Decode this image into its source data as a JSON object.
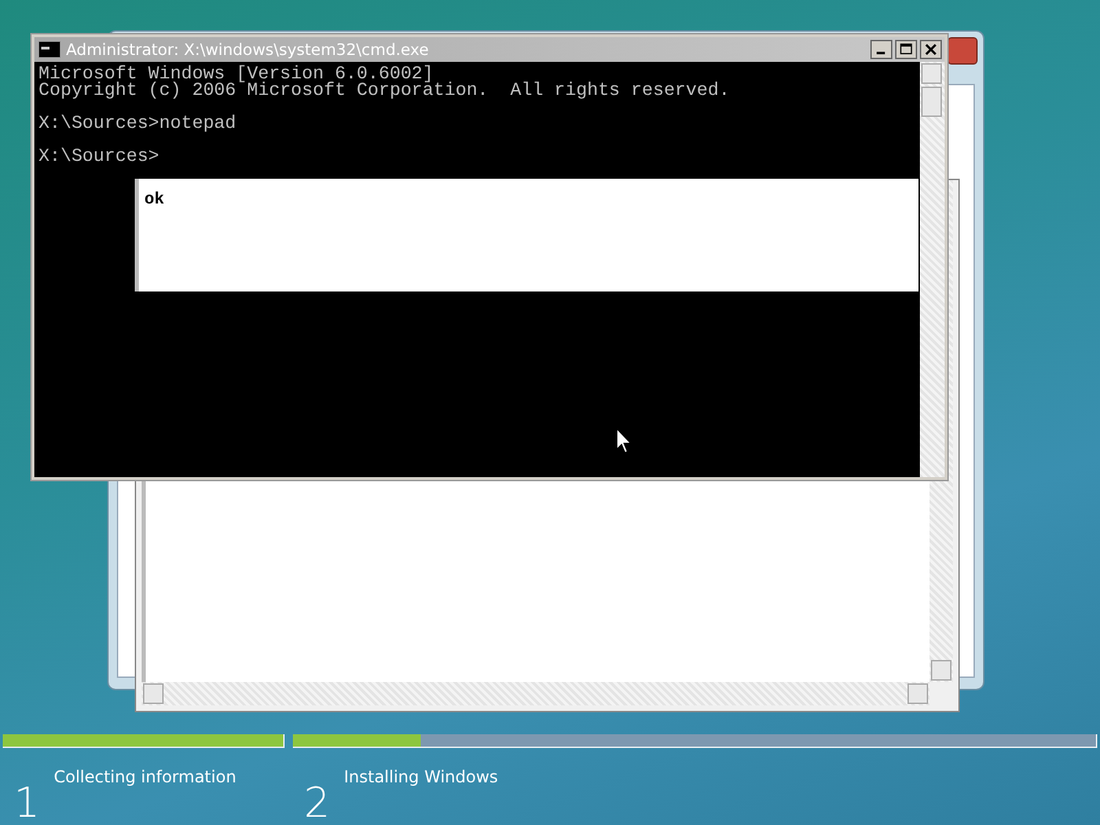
{
  "cmd_window": {
    "title": "Administrator: X:\\windows\\system32\\cmd.exe",
    "lines": [
      {
        "text": "Microsoft Windows [Version 6.0.6002]",
        "gap_before": false
      },
      {
        "text": "Copyright (c) 2006 Microsoft Corporation.  All rights reserved.",
        "gap_before": false
      },
      {
        "text": "X:\\Sources>notepad",
        "gap_before": true
      },
      {
        "text": "X:\\Sources>",
        "gap_before": true
      }
    ]
  },
  "notepad": {
    "text": "ok"
  },
  "setup_progress": {
    "steps": [
      {
        "number": "1",
        "label": "Collecting information",
        "level": 1
      },
      {
        "number": "2",
        "label": "Installing Windows",
        "level": 0.16
      }
    ]
  }
}
